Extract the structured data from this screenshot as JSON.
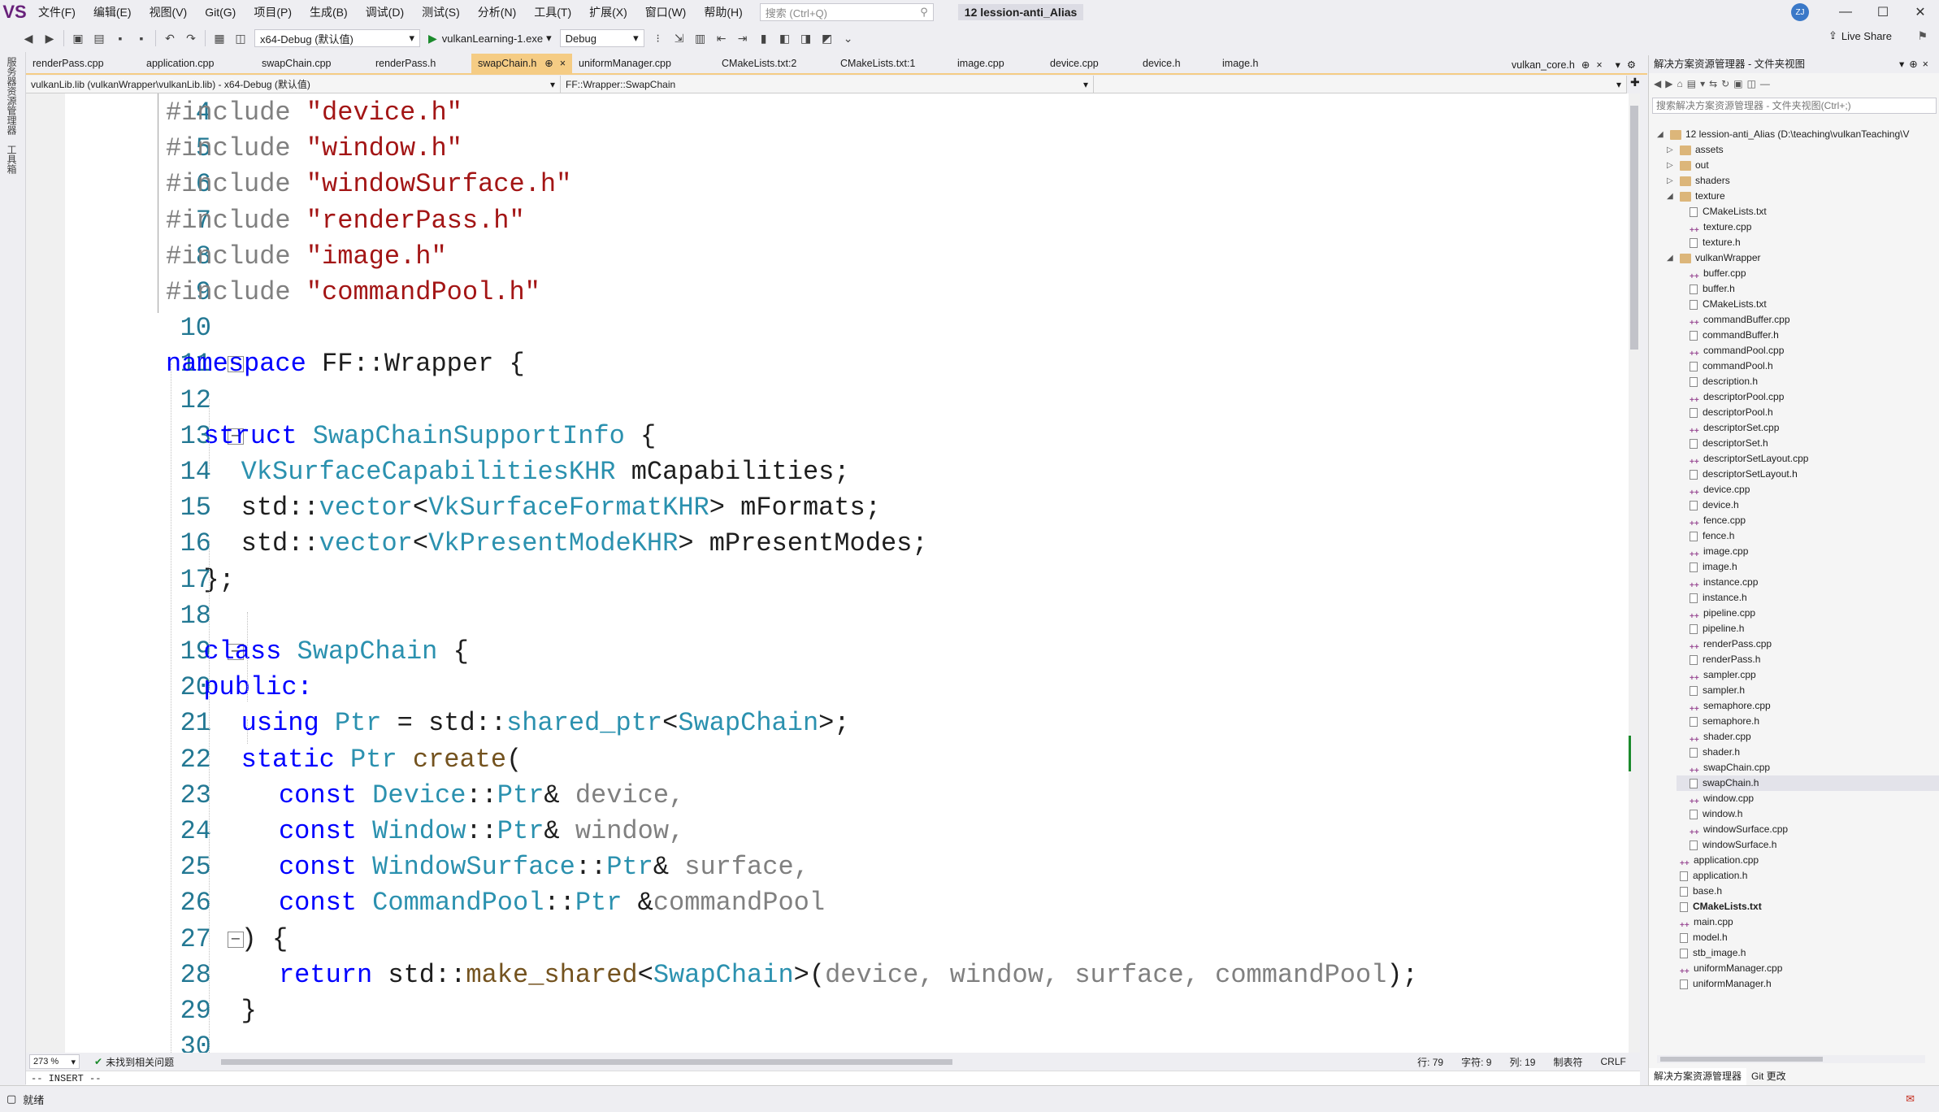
{
  "menubar": {
    "logo": "VS",
    "items": [
      "文件(F)",
      "编辑(E)",
      "视图(V)",
      "Git(G)",
      "项目(P)",
      "生成(B)",
      "调试(D)",
      "测试(S)",
      "分析(N)",
      "工具(T)",
      "扩展(X)",
      "窗口(W)",
      "帮助(H)"
    ],
    "search_placeholder": "搜索 (Ctrl+Q)",
    "solution_title": "12 lession-anti_Alias",
    "avatar": "ZJ"
  },
  "toolbar": {
    "config": "x64-Debug (默认值)",
    "startup": "vulkanLearning-1.exe",
    "build_mode": "Debug",
    "live_share": "Live Share"
  },
  "left_strip": {
    "tab1": "服务器资源管理器",
    "tab2": "工具箱"
  },
  "tabs": [
    {
      "label": "renderPass.cpp",
      "w": 140
    },
    {
      "label": "application.cpp",
      "w": 142
    },
    {
      "label": "swapChain.cpp",
      "w": 140
    },
    {
      "label": "renderPass.h",
      "w": 126
    },
    {
      "label": "swapChain.h",
      "w": 124,
      "active": true,
      "pin": "⊕",
      "close": "×"
    },
    {
      "label": "uniformManager.cpp",
      "w": 176
    },
    {
      "label": "CMakeLists.txt:2",
      "w": 146
    },
    {
      "label": "CMakeLists.txt:1",
      "w": 144
    },
    {
      "label": "image.cpp",
      "w": 114
    },
    {
      "label": "device.cpp",
      "w": 114
    },
    {
      "label": "device.h",
      "w": 98
    },
    {
      "label": "image.h",
      "w": 98
    }
  ],
  "overflow_tab": "vulkan_core.h",
  "nav": {
    "project": "vulkanLib.lib (vulkanWrapper\\vulkanLib.lib) - x64-Debug (默认值)",
    "scope": "FF::Wrapper::SwapChain"
  },
  "code_lines": [
    {
      "n": "4",
      "fold": "",
      "indent": 0,
      "spans": [
        {
          "t": "#include ",
          "c": "pp"
        },
        {
          "t": "\"device.h\"",
          "c": "s"
        }
      ]
    },
    {
      "n": "5",
      "fold": "",
      "indent": 0,
      "spans": [
        {
          "t": "#include ",
          "c": "pp"
        },
        {
          "t": "\"window.h\"",
          "c": "s"
        }
      ]
    },
    {
      "n": "6",
      "fold": "",
      "indent": 0,
      "spans": [
        {
          "t": "#include ",
          "c": "pp"
        },
        {
          "t": "\"windowSurface.h\"",
          "c": "s"
        }
      ]
    },
    {
      "n": "7",
      "fold": "",
      "indent": 0,
      "spans": [
        {
          "t": "#include ",
          "c": "pp"
        },
        {
          "t": "\"renderPass.h\"",
          "c": "s"
        }
      ]
    },
    {
      "n": "8",
      "fold": "",
      "indent": 0,
      "spans": [
        {
          "t": "#include ",
          "c": "pp"
        },
        {
          "t": "\"image.h\"",
          "c": "s"
        }
      ]
    },
    {
      "n": "9",
      "fold": "",
      "indent": 0,
      "spans": [
        {
          "t": "#include ",
          "c": "pp"
        },
        {
          "t": "\"commandPool.h\"",
          "c": "s"
        }
      ]
    },
    {
      "n": "10",
      "fold": "",
      "indent": 0,
      "spans": []
    },
    {
      "n": "11",
      "fold": "−",
      "indent": 0,
      "spans": [
        {
          "t": "namespace ",
          "c": "k"
        },
        {
          "t": "FF::Wrapper {",
          "c": "n"
        }
      ]
    },
    {
      "n": "12",
      "fold": "",
      "indent": 0,
      "spans": []
    },
    {
      "n": "13",
      "fold": "−",
      "indent": 2,
      "spans": [
        {
          "t": "struct ",
          "c": "k"
        },
        {
          "t": "SwapChainSupportInfo",
          "c": "t"
        },
        {
          "t": " {",
          "c": "n"
        }
      ]
    },
    {
      "n": "14",
      "fold": "",
      "indent": 4,
      "spans": [
        {
          "t": "VkSurfaceCapabilitiesKHR",
          "c": "t"
        },
        {
          "t": " mCapabilities;",
          "c": "n"
        }
      ]
    },
    {
      "n": "15",
      "fold": "",
      "indent": 4,
      "spans": [
        {
          "t": "std::",
          "c": "n"
        },
        {
          "t": "vector",
          "c": "t"
        },
        {
          "t": "<",
          "c": "n"
        },
        {
          "t": "VkSurfaceFormatKHR",
          "c": "t"
        },
        {
          "t": "> mFormats;",
          "c": "n"
        }
      ]
    },
    {
      "n": "16",
      "fold": "",
      "indent": 4,
      "spans": [
        {
          "t": "std::",
          "c": "n"
        },
        {
          "t": "vector",
          "c": "t"
        },
        {
          "t": "<",
          "c": "n"
        },
        {
          "t": "VkPresentModeKHR",
          "c": "t"
        },
        {
          "t": "> mPresentModes;",
          "c": "n"
        }
      ]
    },
    {
      "n": "17",
      "fold": "",
      "indent": 2,
      "spans": [
        {
          "t": "};",
          "c": "n"
        }
      ]
    },
    {
      "n": "18",
      "fold": "",
      "indent": 0,
      "spans": []
    },
    {
      "n": "19",
      "fold": "−",
      "indent": 2,
      "spans": [
        {
          "t": "class ",
          "c": "k"
        },
        {
          "t": "SwapChain",
          "c": "t"
        },
        {
          "t": " {",
          "c": "n"
        }
      ]
    },
    {
      "n": "20",
      "fold": "",
      "indent": 2,
      "spans": [
        {
          "t": "public:",
          "c": "k"
        }
      ]
    },
    {
      "n": "21",
      "fold": "",
      "indent": 4,
      "spans": [
        {
          "t": "using ",
          "c": "k"
        },
        {
          "t": "Ptr",
          "c": "t"
        },
        {
          "t": " = std::",
          "c": "n"
        },
        {
          "t": "shared_ptr",
          "c": "t"
        },
        {
          "t": "<",
          "c": "n"
        },
        {
          "t": "SwapChain",
          "c": "t"
        },
        {
          "t": ">;",
          "c": "n"
        }
      ]
    },
    {
      "n": "22",
      "fold": "",
      "indent": 4,
      "spans": [
        {
          "t": "static ",
          "c": "k"
        },
        {
          "t": "Ptr",
          "c": "t"
        },
        {
          "t": " ",
          "c": "n"
        },
        {
          "t": "create",
          "c": "f"
        },
        {
          "t": "(",
          "c": "n"
        }
      ]
    },
    {
      "n": "23",
      "fold": "",
      "indent": 6,
      "spans": [
        {
          "t": "const ",
          "c": "k"
        },
        {
          "t": "Device",
          "c": "t"
        },
        {
          "t": "::",
          "c": "n"
        },
        {
          "t": "Ptr",
          "c": "t"
        },
        {
          "t": "& ",
          "c": "n"
        },
        {
          "t": "device,",
          "c": "p"
        }
      ]
    },
    {
      "n": "24",
      "fold": "",
      "indent": 6,
      "spans": [
        {
          "t": "const ",
          "c": "k"
        },
        {
          "t": "Window",
          "c": "t"
        },
        {
          "t": "::",
          "c": "n"
        },
        {
          "t": "Ptr",
          "c": "t"
        },
        {
          "t": "& ",
          "c": "n"
        },
        {
          "t": "window,",
          "c": "p"
        }
      ]
    },
    {
      "n": "25",
      "fold": "",
      "indent": 6,
      "spans": [
        {
          "t": "const ",
          "c": "k"
        },
        {
          "t": "WindowSurface",
          "c": "t"
        },
        {
          "t": "::",
          "c": "n"
        },
        {
          "t": "Ptr",
          "c": "t"
        },
        {
          "t": "& ",
          "c": "n"
        },
        {
          "t": "surface,",
          "c": "p"
        }
      ]
    },
    {
      "n": "26",
      "fold": "",
      "indent": 6,
      "spans": [
        {
          "t": "const ",
          "c": "k"
        },
        {
          "t": "CommandPool",
          "c": "t"
        },
        {
          "t": "::",
          "c": "n"
        },
        {
          "t": "Ptr",
          "c": "t"
        },
        {
          "t": " &",
          "c": "n"
        },
        {
          "t": "commandPool",
          "c": "p"
        }
      ]
    },
    {
      "n": "27",
      "fold": "−",
      "indent": 4,
      "spans": [
        {
          "t": ") {",
          "c": "n"
        }
      ]
    },
    {
      "n": "28",
      "fold": "",
      "indent": 6,
      "spans": [
        {
          "t": "return ",
          "c": "k"
        },
        {
          "t": "std::",
          "c": "n"
        },
        {
          "t": "make_shared",
          "c": "f"
        },
        {
          "t": "<",
          "c": "n"
        },
        {
          "t": "SwapChain",
          "c": "t"
        },
        {
          "t": ">(",
          "c": "n"
        },
        {
          "t": "device, window, surface, commandPool",
          "c": "p"
        },
        {
          "t": ");",
          "c": "n"
        }
      ]
    },
    {
      "n": "29",
      "fold": "",
      "indent": 4,
      "spans": [
        {
          "t": "}",
          "c": "n"
        }
      ]
    },
    {
      "n": "30",
      "fold": "",
      "indent": 0,
      "spans": []
    }
  ],
  "editor_status": {
    "zoom": "273 %",
    "issues": "未找到相关问题",
    "line": "行: 79",
    "char": "字符: 9",
    "col": "列: 19",
    "tabs": "制表符",
    "eol": "CRLF"
  },
  "insert_mode": "-- INSERT --",
  "solution_explorer": {
    "title": "解决方案资源管理器 - 文件夹视图",
    "search_placeholder": "搜索解决方案资源管理器 - 文件夹视图(Ctrl+;)",
    "tree": [
      {
        "label": "12 lession-anti_Alias (D:\\teaching\\vulkanTeaching\\V",
        "level": 0,
        "type": "folder",
        "arrow": "◢"
      },
      {
        "label": "assets",
        "level": 1,
        "type": "folder",
        "arrow": "▷"
      },
      {
        "label": "out",
        "level": 1,
        "type": "folder",
        "arrow": "▷"
      },
      {
        "label": "shaders",
        "level": 1,
        "type": "folder",
        "arrow": "▷"
      },
      {
        "label": "texture",
        "level": 1,
        "type": "folder",
        "arrow": "◢"
      },
      {
        "label": "CMakeLists.txt",
        "level": 2,
        "type": "file"
      },
      {
        "label": "texture.cpp",
        "level": 2,
        "type": "cpp"
      },
      {
        "label": "texture.h",
        "level": 2,
        "type": "file"
      },
      {
        "label": "vulkanWrapper",
        "level": 1,
        "type": "folder",
        "arrow": "◢"
      },
      {
        "label": "buffer.cpp",
        "level": 2,
        "type": "cpp"
      },
      {
        "label": "buffer.h",
        "level": 2,
        "type": "file"
      },
      {
        "label": "CMakeLists.txt",
        "level": 2,
        "type": "file"
      },
      {
        "label": "commandBuffer.cpp",
        "level": 2,
        "type": "cpp"
      },
      {
        "label": "commandBuffer.h",
        "level": 2,
        "type": "file"
      },
      {
        "label": "commandPool.cpp",
        "level": 2,
        "type": "cpp"
      },
      {
        "label": "commandPool.h",
        "level": 2,
        "type": "file"
      },
      {
        "label": "description.h",
        "level": 2,
        "type": "file"
      },
      {
        "label": "descriptorPool.cpp",
        "level": 2,
        "type": "cpp"
      },
      {
        "label": "descriptorPool.h",
        "level": 2,
        "type": "file"
      },
      {
        "label": "descriptorSet.cpp",
        "level": 2,
        "type": "cpp"
      },
      {
        "label": "descriptorSet.h",
        "level": 2,
        "type": "file"
      },
      {
        "label": "descriptorSetLayout.cpp",
        "level": 2,
        "type": "cpp"
      },
      {
        "label": "descriptorSetLayout.h",
        "level": 2,
        "type": "file"
      },
      {
        "label": "device.cpp",
        "level": 2,
        "type": "cpp"
      },
      {
        "label": "device.h",
        "level": 2,
        "type": "file"
      },
      {
        "label": "fence.cpp",
        "level": 2,
        "type": "cpp"
      },
      {
        "label": "fence.h",
        "level": 2,
        "type": "file"
      },
      {
        "label": "image.cpp",
        "level": 2,
        "type": "cpp"
      },
      {
        "label": "image.h",
        "level": 2,
        "type": "file"
      },
      {
        "label": "instance.cpp",
        "level": 2,
        "type": "cpp"
      },
      {
        "label": "instance.h",
        "level": 2,
        "type": "file"
      },
      {
        "label": "pipeline.cpp",
        "level": 2,
        "type": "cpp"
      },
      {
        "label": "pipeline.h",
        "level": 2,
        "type": "file"
      },
      {
        "label": "renderPass.cpp",
        "level": 2,
        "type": "cpp"
      },
      {
        "label": "renderPass.h",
        "level": 2,
        "type": "file"
      },
      {
        "label": "sampler.cpp",
        "level": 2,
        "type": "cpp"
      },
      {
        "label": "sampler.h",
        "level": 2,
        "type": "file"
      },
      {
        "label": "semaphore.cpp",
        "level": 2,
        "type": "cpp"
      },
      {
        "label": "semaphore.h",
        "level": 2,
        "type": "file"
      },
      {
        "label": "shader.cpp",
        "level": 2,
        "type": "cpp"
      },
      {
        "label": "shader.h",
        "level": 2,
        "type": "file"
      },
      {
        "label": "swapChain.cpp",
        "level": 2,
        "type": "cpp"
      },
      {
        "label": "swapChain.h",
        "level": 2,
        "type": "file",
        "selected": true
      },
      {
        "label": "window.cpp",
        "level": 2,
        "type": "cpp"
      },
      {
        "label": "window.h",
        "level": 2,
        "type": "file"
      },
      {
        "label": "windowSurface.cpp",
        "level": 2,
        "type": "cpp"
      },
      {
        "label": "windowSurface.h",
        "level": 2,
        "type": "file"
      },
      {
        "label": "application.cpp",
        "level": 1,
        "type": "cpp"
      },
      {
        "label": "application.h",
        "level": 1,
        "type": "file"
      },
      {
        "label": "base.h",
        "level": 1,
        "type": "file"
      },
      {
        "label": "CMakeLists.txt",
        "level": 1,
        "type": "file",
        "bold": true
      },
      {
        "label": "main.cpp",
        "level": 1,
        "type": "cpp"
      },
      {
        "label": "model.h",
        "level": 1,
        "type": "file"
      },
      {
        "label": "stb_image.h",
        "level": 1,
        "type": "file"
      },
      {
        "label": "uniformManager.cpp",
        "level": 1,
        "type": "cpp"
      },
      {
        "label": "uniformManager.h",
        "level": 1,
        "type": "file"
      }
    ],
    "bottom_tabs": [
      "解决方案资源管理器",
      "Git 更改"
    ]
  },
  "statusbar": {
    "ready": "就绪"
  },
  "colors": {
    "active_tab": "#f5cc84",
    "keyword": "#0000ff",
    "type": "#2b91af",
    "string": "#a31515",
    "line_number": "#237893"
  }
}
